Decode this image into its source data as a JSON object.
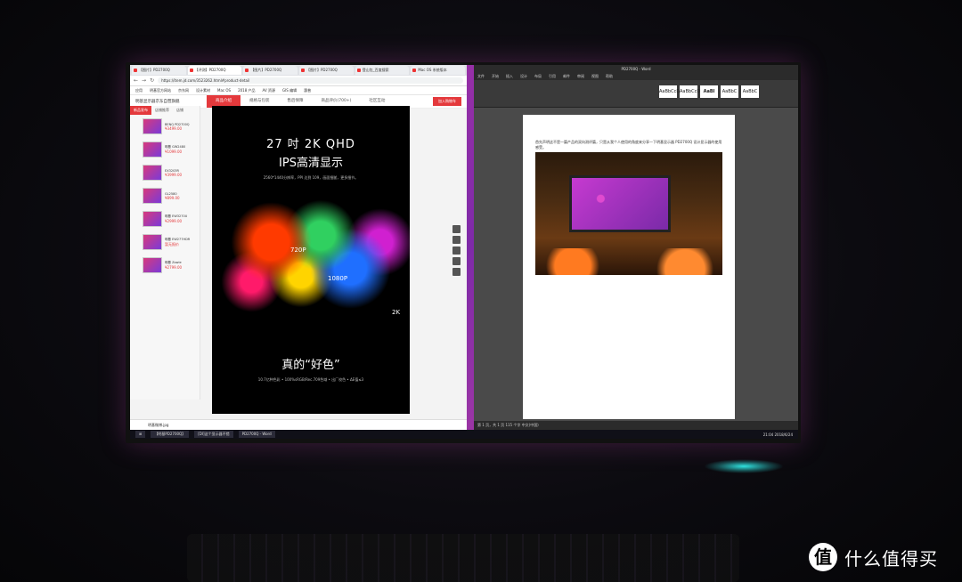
{
  "browser": {
    "tabs": [
      "【图片】PD2700Q",
      "【评测】PD2700Q",
      "【图片】PD2700Q",
      "【图片】PD2700Q",
      "登山包_百度搜索",
      "Mac OS 系统版本"
    ],
    "url": "https://item.jd.com/3523262.html#product-detail",
    "bookmarks": [
      "应用",
      "明基官方网站",
      "京东网",
      "设计素材",
      "Mac OS",
      "2018 产品",
      "AV 资源",
      "GIS 编辑",
      "惠普"
    ],
    "store_title": "明基显示器京东自营旗舰",
    "nav_tabs": [
      "商品介绍",
      "规格与包装",
      "售后保障",
      "商品评价(700+)",
      "社区互动"
    ],
    "buy_button": "加入购物车",
    "side_tabs": [
      "新品发布",
      "店铺推荐",
      "店铺"
    ],
    "side_items": [
      {
        "name": "BENQ PD2700Q",
        "price": "¥3499.00"
      },
      {
        "name": "明基 GW2480",
        "price": "¥1099.00"
      },
      {
        "name": "EX3203R",
        "price": "¥3999.00"
      },
      {
        "name": "GL2580",
        "price": "¥899.00"
      },
      {
        "name": "明基 EW3270U",
        "price": "¥2999.00"
      },
      {
        "name": "明基 EW277HDR",
        "price": "暂无报价"
      },
      {
        "name": "明基 Zowie",
        "price": "¥2799.00"
      }
    ],
    "poster": {
      "title": "27 吋 2K QHD",
      "subtitle": "IPS高清显示",
      "desc": "2560*1440分辨率，PPI 达到 109，画面细腻，更多细节。",
      "labels": [
        "720P",
        "1080P",
        "2K"
      ],
      "color_title": "真的“好色”",
      "color_desc": "10.7亿种色彩 • 100%sRGB/Rec.709色域 • 出厂校色 • ΔE值≤3"
    },
    "download_file": "明基微博.jpg"
  },
  "word": {
    "title": "PD2700Q - Word",
    "menu": [
      "文件",
      "开始",
      "插入",
      "设计",
      "布局",
      "引用",
      "邮件",
      "审阅",
      "视图",
      "帮助"
    ],
    "styles": [
      "AaBbCcDd",
      "AaBbCcD",
      "AaBl",
      "AaBbC",
      "AaBbC"
    ],
    "paragraph": "首先声明这不是一篇产品的双向测评篇，只是从我个人使用的角度来分享一下明基显示器 PD2700Q 设计显示器的使用感受。",
    "status": "第 1 页，共 1 页    115 个字    中文(中国)"
  },
  "taskbar": {
    "items": [
      "【明基PD2700Q】",
      "[DI]这个显示器不错",
      "PD2700Q - Word"
    ],
    "clock": "21:04 2018/6/24"
  },
  "watermark": "什么值得买",
  "watermark_logo": "值"
}
